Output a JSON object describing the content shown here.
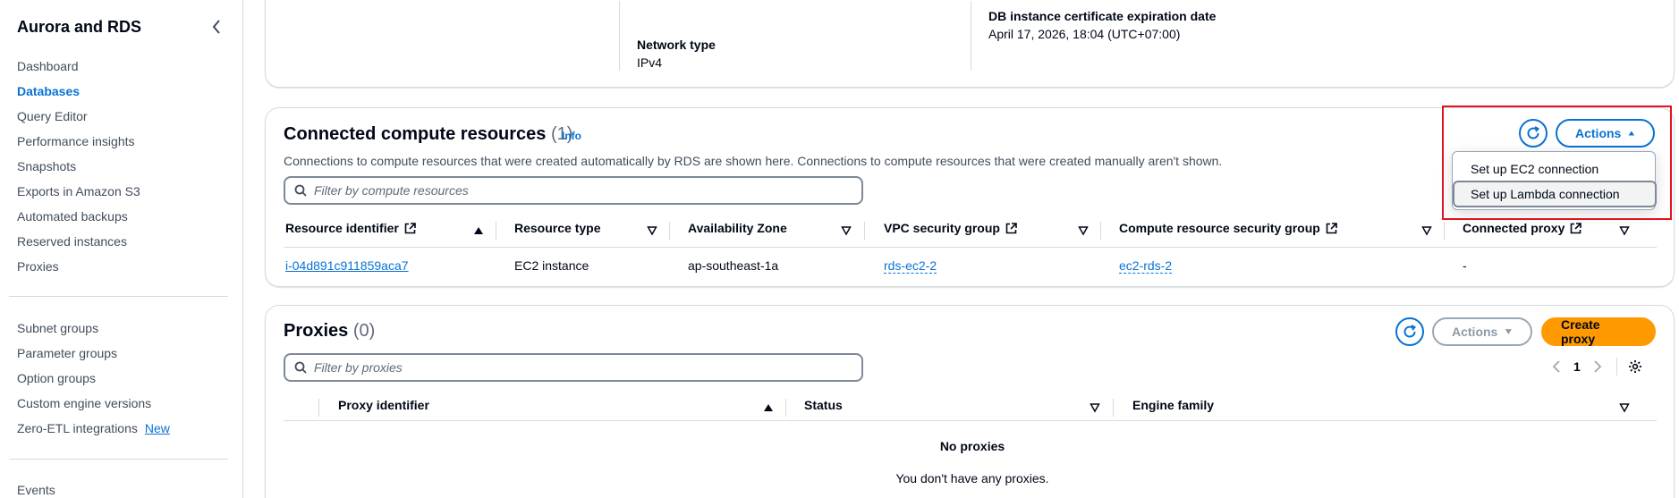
{
  "sidebar": {
    "title": "Aurora and RDS",
    "group1": [
      "Dashboard",
      "Databases",
      "Query Editor",
      "Performance insights",
      "Snapshots",
      "Exports in Amazon S3",
      "Automated backups",
      "Reserved instances",
      "Proxies"
    ],
    "group2": [
      "Subnet groups",
      "Parameter groups",
      "Option groups",
      "Custom engine versions",
      "Zero-ETL integrations"
    ],
    "new_badge": "New",
    "group3": [
      "Events"
    ]
  },
  "details": {
    "network_type_label": "Network type",
    "network_type_value": "IPv4",
    "cert_label": "DB instance certificate expiration date",
    "cert_value": "April 17, 2026, 18:04 (UTC+07:00)"
  },
  "connected": {
    "title": "Connected compute resources",
    "count": "(1)",
    "info": "Info",
    "description": "Connections to compute resources that were created automatically by RDS are shown here. Connections to compute resources that were created manually aren't shown.",
    "filter_placeholder": "Filter by compute resources",
    "actions_label": "Actions",
    "menu": [
      "Set up EC2 connection",
      "Set up Lambda connection"
    ],
    "columns": [
      "Resource identifier",
      "Resource type",
      "Availability Zone",
      "VPC security group",
      "Compute resource security group",
      "Connected proxy"
    ],
    "row": {
      "resource_identifier": "i-04d891c911859aca7",
      "resource_type": "EC2 instance",
      "availability_zone": "ap-southeast-1a",
      "vpc_security_group": "rds-ec2-2",
      "compute_security_group": "ec2-rds-2",
      "connected_proxy": "-"
    }
  },
  "proxies": {
    "title": "Proxies",
    "count": "(0)",
    "actions_label": "Actions",
    "create_label": "Create proxy",
    "filter_placeholder": "Filter by proxies",
    "page": "1",
    "columns": [
      "Proxy identifier",
      "Status",
      "Engine family"
    ],
    "empty_title": "No proxies",
    "empty_desc": "You don't have any proxies."
  },
  "colors": {
    "link": "#0972d3",
    "primary": "#ff9900",
    "highlight": "#e0141e"
  }
}
